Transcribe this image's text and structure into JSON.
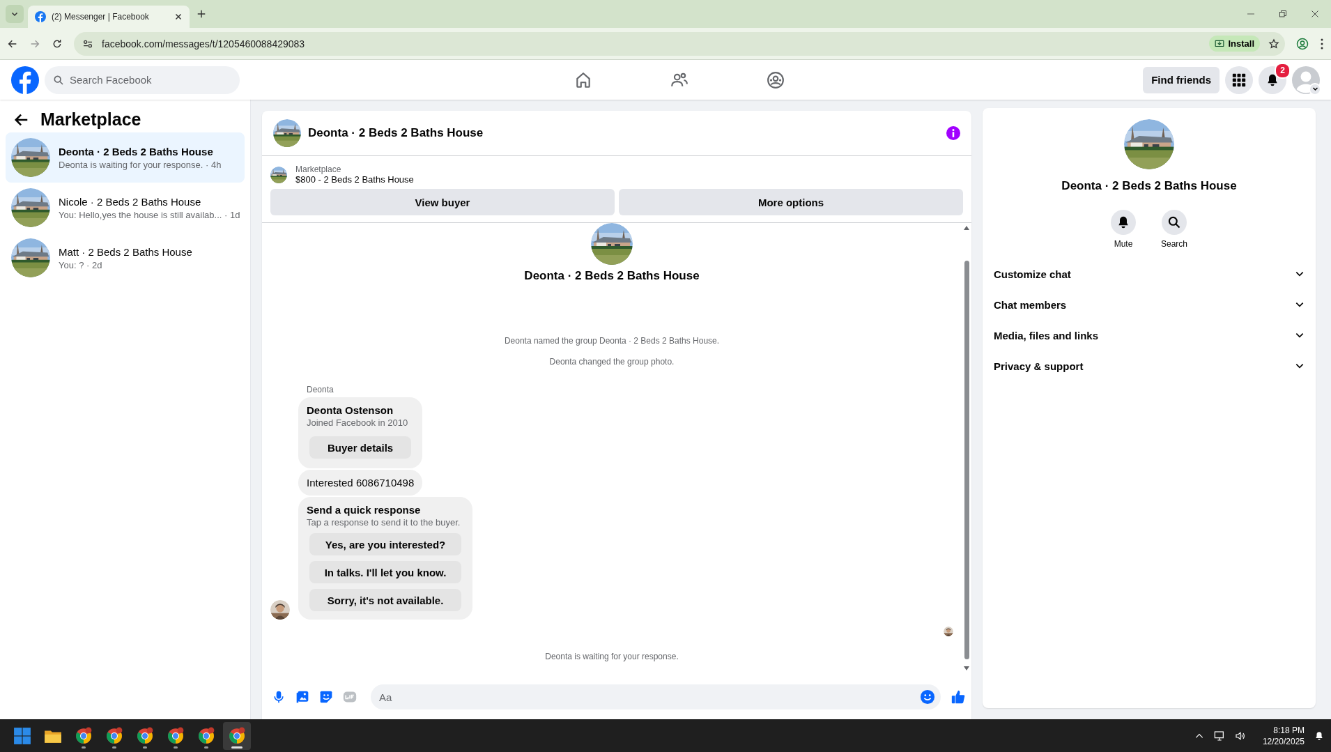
{
  "browser": {
    "tab_title": "(2) Messenger | Facebook",
    "url": "facebook.com/messages/t/1205460088429083",
    "install_label": "Install"
  },
  "header": {
    "search_placeholder": "Search Facebook",
    "find_friends": "Find friends",
    "notification_count": "2",
    "nav": [
      {
        "kind": "home"
      },
      {
        "kind": "friends"
      },
      {
        "kind": "groups"
      }
    ]
  },
  "sidebar": {
    "title": "Marketplace",
    "conversations": [
      {
        "title": "Deonta · 2 Beds 2 Baths House",
        "preview": "Deonta is waiting for your response. · 4h",
        "selected": true
      },
      {
        "title": "Nicole · 2 Beds 2 Baths House",
        "preview": "You: Hello,yes the house is still availab... · 1d",
        "selected": false
      },
      {
        "title": "Matt · 2 Beds 2 Baths House",
        "preview": "You: ? · 2d",
        "selected": false
      }
    ]
  },
  "chat": {
    "title": "Deonta · 2 Beds 2 Baths House",
    "listing": {
      "source": "Marketplace",
      "title": "$800 - 2 Beds 2 Baths House"
    },
    "actions": [
      "View buyer",
      "More options"
    ],
    "intro_title": "Deonta · 2 Beds 2 Baths House",
    "events": [
      "Deonta named the group Deonta · 2 Beds 2 Baths House.",
      "Deonta changed the group photo."
    ],
    "sender": "Deonta",
    "card": {
      "name": "Deonta Ostenson",
      "joined": "Joined Facebook in 2010",
      "button": "Buyer details"
    },
    "message": "Interested 6086710498",
    "quick": {
      "title": "Send a quick response",
      "subtitle": "Tap a response to send it to the buyer.",
      "responses": [
        "Yes, are you interested?",
        "In talks. I'll let you know.",
        "Sorry, it's not available."
      ]
    },
    "status": "Deonta is waiting for your response.",
    "composer": {
      "placeholder": "Aa"
    }
  },
  "details": {
    "title": "Deonta · 2 Beds 2 Baths House",
    "actions": [
      {
        "kind": "mute",
        "label": "Mute"
      },
      {
        "kind": "search",
        "label": "Search"
      }
    ],
    "sections": [
      "Customize chat",
      "Chat members",
      "Media, files and links",
      "Privacy & support"
    ]
  },
  "taskbar": {
    "apps": [
      {
        "kind": "start",
        "selected": false
      },
      {
        "kind": "files",
        "selected": false
      },
      {
        "kind": "chrome",
        "selected": false
      },
      {
        "kind": "chrome",
        "selected": false
      },
      {
        "kind": "chrome",
        "selected": false
      },
      {
        "kind": "chrome",
        "selected": false
      },
      {
        "kind": "chrome",
        "selected": false
      },
      {
        "kind": "chrome",
        "selected": true
      }
    ],
    "time": "8:18 PM",
    "date": "12/20/2025"
  }
}
